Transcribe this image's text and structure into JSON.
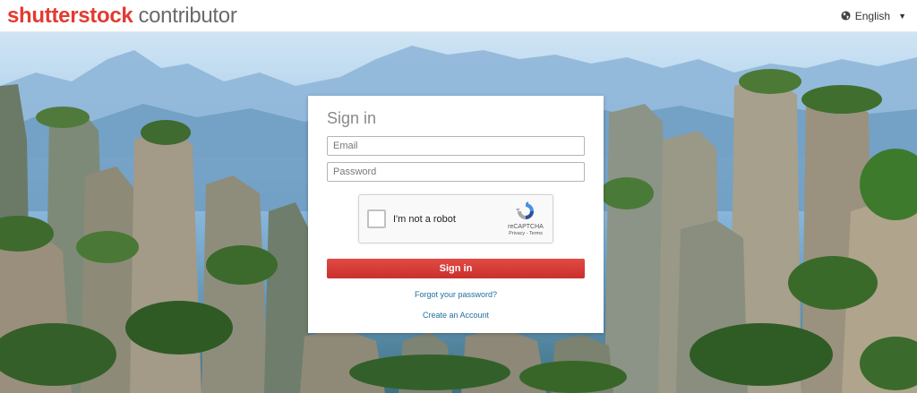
{
  "header": {
    "brand": "shutterstock",
    "subtitle": "contributor",
    "language": {
      "label": "English",
      "icon": "globe-icon",
      "dropdown_icon": "caret-down-icon"
    }
  },
  "signin": {
    "title": "Sign in",
    "email_placeholder": "Email",
    "password_placeholder": "Password",
    "captcha": {
      "label": "I'm not a robot",
      "brand": "reCAPTCHA",
      "links": "Privacy - Terms"
    },
    "button_label": "Sign in",
    "forgot_link": "Forgot your password?",
    "create_link": "Create an Account"
  },
  "colors": {
    "brand_red": "#e33a31",
    "button_red": "#c9302c",
    "link_blue": "#1f6f9f"
  }
}
